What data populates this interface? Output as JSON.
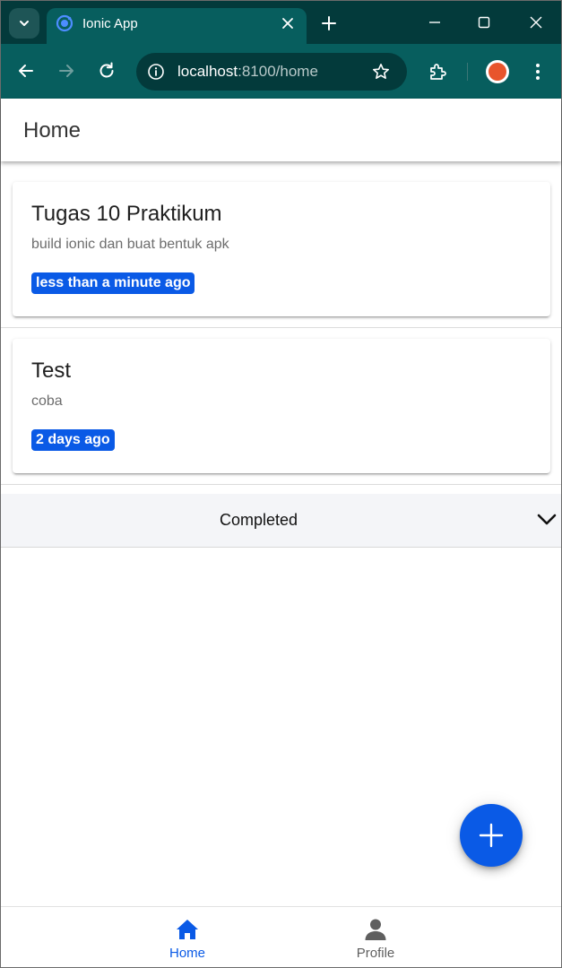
{
  "browser": {
    "tab_title": "Ionic App",
    "url_host": "localhost",
    "url_rest": ":8100/home"
  },
  "app": {
    "title": "Home",
    "tasks": [
      {
        "title": "Tugas 10 Praktikum",
        "description": "build ionic dan buat bentuk apk",
        "time_badge": "less than a minute ago"
      },
      {
        "title": "Test",
        "description": "coba",
        "time_badge": "2 days ago"
      }
    ],
    "completed_section": {
      "label": "Completed"
    },
    "tabs": [
      {
        "label": "Home",
        "icon": "home-icon",
        "selected": true
      },
      {
        "label": "Profile",
        "icon": "person-icon",
        "selected": false
      }
    ]
  },
  "colors": {
    "primary": "#0a5ae6",
    "chrome_dark": "#033a3b",
    "chrome_toolbar": "#075e5e"
  }
}
